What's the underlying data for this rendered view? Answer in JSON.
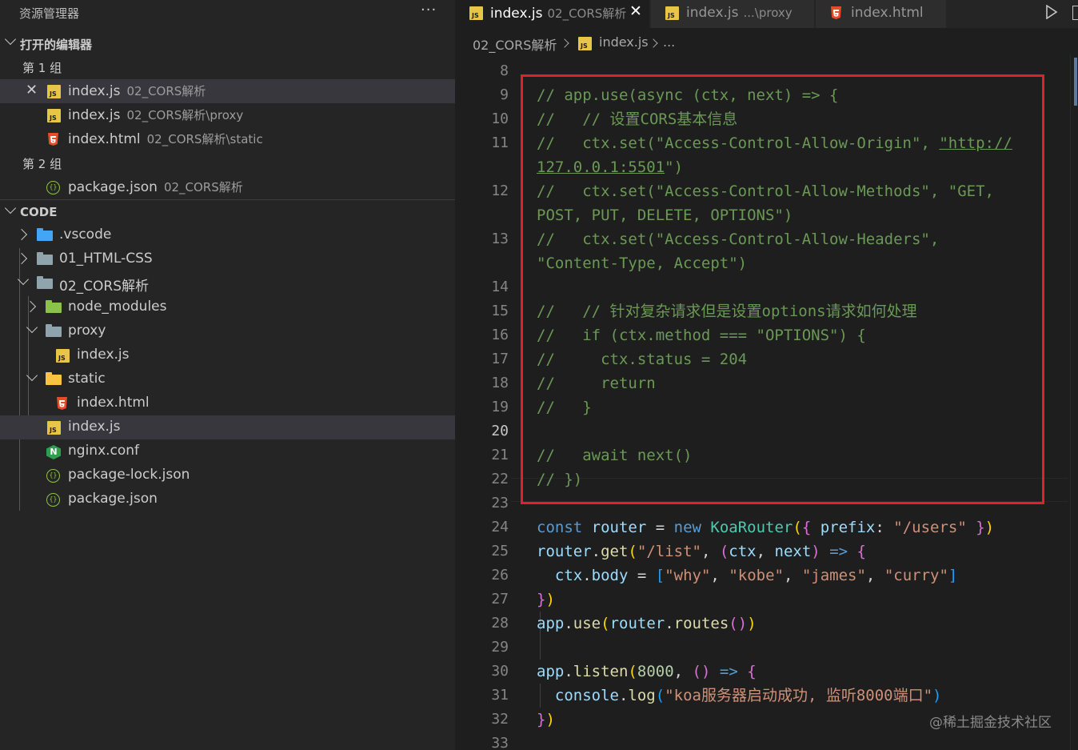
{
  "sidebar": {
    "title": "资源管理器",
    "more": "···",
    "open_editors": {
      "label": "打开的编辑器",
      "groups": [
        {
          "label": "第 1 组",
          "items": [
            {
              "name": "index.js",
              "desc": "02_CORS解析",
              "icon": "js-file-icon"
            },
            {
              "name": "index.js",
              "desc": "02_CORS解析\\proxy",
              "icon": "js-file-icon"
            },
            {
              "name": "index.html",
              "desc": "02_CORS解析\\static",
              "icon": "html-file-icon"
            }
          ]
        },
        {
          "label": "第 2 组",
          "items": [
            {
              "name": "package.json",
              "desc": "02_CORS解析",
              "icon": "json-file-icon"
            }
          ]
        }
      ]
    },
    "workspace": {
      "label": "CODE",
      "tree": [
        ".vscode",
        "01_HTML-CSS",
        "02_CORS解析",
        "node_modules",
        "proxy",
        "index.js",
        "static",
        "index.html",
        "index.js",
        "nginx.conf",
        "package-lock.json",
        "package.json"
      ]
    }
  },
  "tabs": [
    {
      "label": "index.js",
      "desc": "02_CORS解析",
      "active": true,
      "close": "✕"
    },
    {
      "label": "index.js",
      "desc": "...\\proxy",
      "active": false
    },
    {
      "label": "index.html",
      "desc": "",
      "active": false
    }
  ],
  "breadcrumb": [
    "02_CORS解析",
    "index.js",
    "..."
  ],
  "editor": {
    "current_line": 20,
    "line_numbers": [
      "8",
      "9",
      "10",
      "11",
      "",
      "12",
      "",
      "13",
      "",
      "14",
      "15",
      "16",
      "17",
      "18",
      "19",
      "20",
      "21",
      "22",
      "23",
      "24",
      "25",
      "26",
      "27",
      "28",
      "29",
      "30",
      "31",
      "32",
      "33"
    ]
  },
  "watermark": "@稀土掘金技术社区",
  "colors": {
    "highlight_box": "#e0202a",
    "accent_js": "#e8c547"
  }
}
